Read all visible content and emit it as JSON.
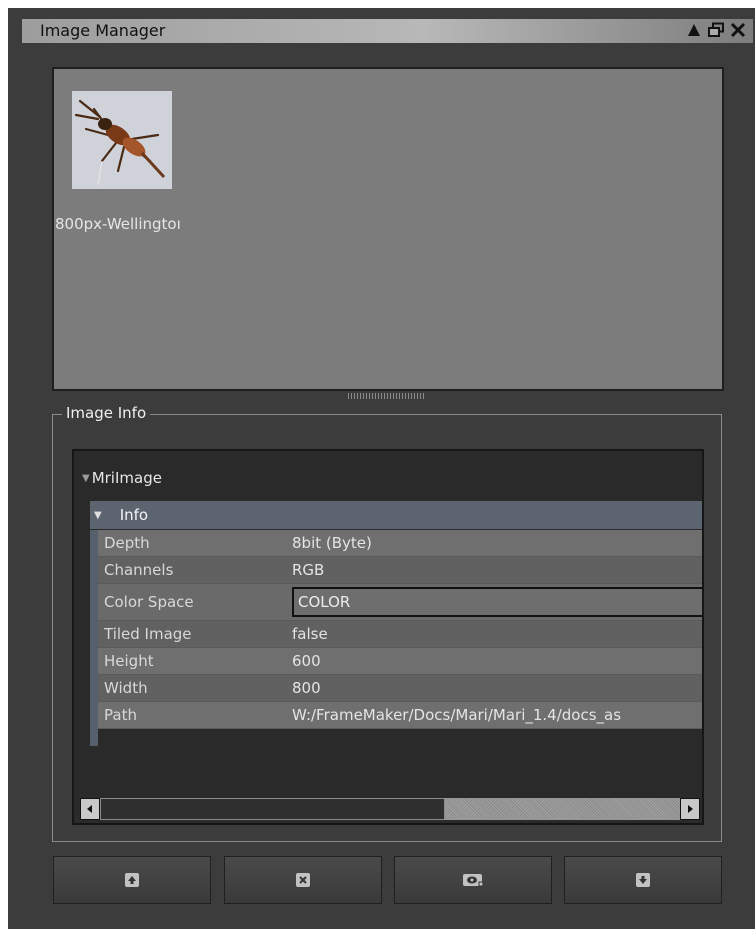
{
  "window": {
    "title": "Image Manager"
  },
  "titlebar_buttons": {
    "float_icon": "triangle-up-icon",
    "restore_icon": "restore-icon",
    "close_icon": "close-icon"
  },
  "thumbnails": [
    {
      "label": "800px-Wellingtoı",
      "icon": "insect-thumbnail"
    }
  ],
  "image_info": {
    "group_title": "Image Info",
    "root_label": "MriImage",
    "section_label": "Info",
    "properties": [
      {
        "key": "Depth",
        "value": "8bit  (Byte)"
      },
      {
        "key": "Channels",
        "value": "RGB"
      },
      {
        "key": "Color Space",
        "value": "COLOR"
      },
      {
        "key": "Tiled Image",
        "value": "false"
      },
      {
        "key": "Height",
        "value": "600"
      },
      {
        "key": "Width",
        "value": "800"
      },
      {
        "key": "Path",
        "value": "W:/FrameMaker/Docs/Mari/Mari_1.4/docs_as"
      }
    ]
  },
  "scrollbar": {
    "left_icon": "arrow-left-icon",
    "right_icon": "arrow-right-icon"
  },
  "bottom_buttons": [
    {
      "name": "import-image-button",
      "icon": "import-icon"
    },
    {
      "name": "remove-image-button",
      "icon": "delete-icon"
    },
    {
      "name": "view-image-button",
      "icon": "eye-icon"
    },
    {
      "name": "export-image-button",
      "icon": "export-icon"
    }
  ],
  "colors": {
    "panel": "#3c3c3c",
    "thumb_area": "#7c7c7c",
    "section_header": "#5c6470"
  }
}
